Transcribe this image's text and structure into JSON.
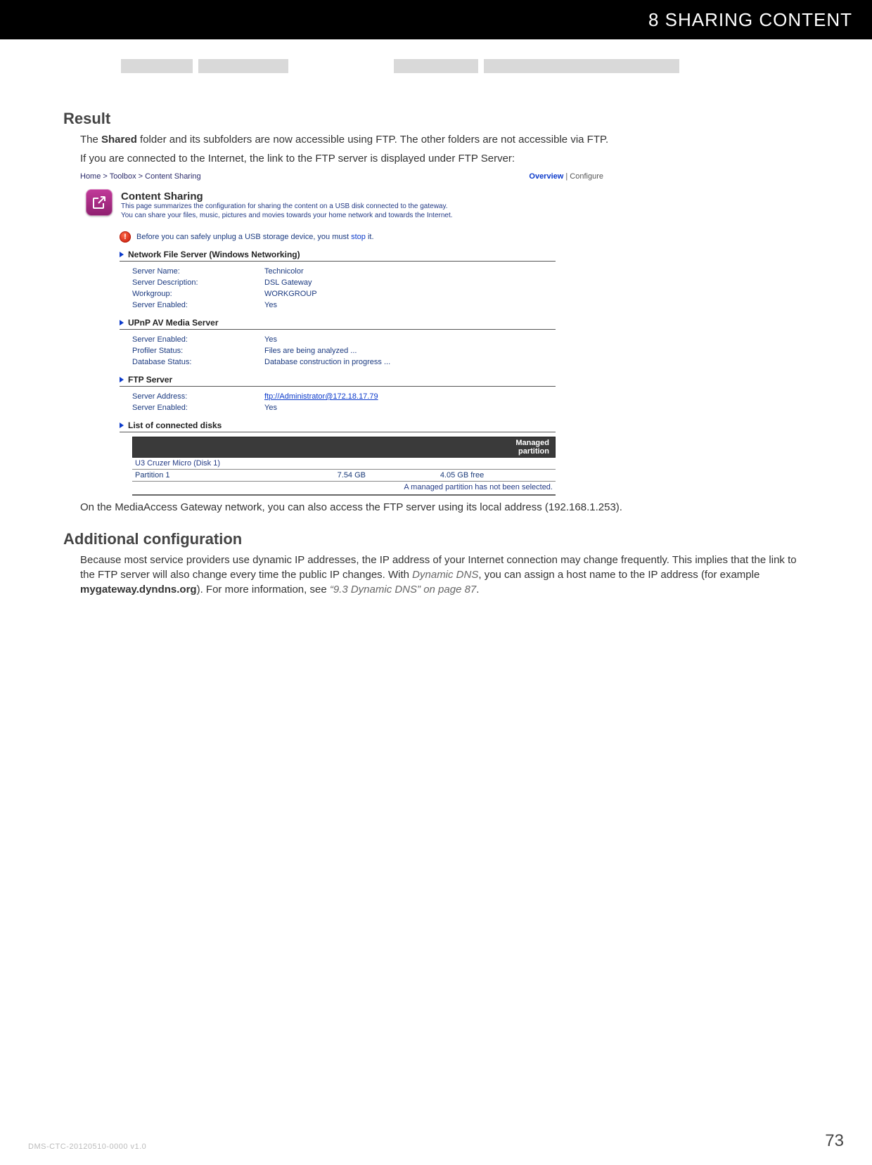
{
  "header": {
    "chapter_number": "8",
    "chapter_title": "SHARING CONTENT"
  },
  "sections": {
    "result": {
      "heading": "Result",
      "p1_a": "The ",
      "p1_bold": "Shared",
      "p1_b": " folder and its subfolders are now accessible using FTP. The other folders are not accessible via FTP.",
      "p2": "If you are connected to the Internet, the link to the FTP server is displayed under FTP Server:",
      "p3_a": "On the MediaAccess Gateway network, you can also access the FTP server using its local address (",
      "p3_ip": "192.168.1.253",
      "p3_b": ")."
    },
    "additional": {
      "heading": "Additional configuration",
      "p_a": "Because most service providers use dynamic IP addresses, the IP address of your Internet connection may change frequently. This implies that the link to the FTP server will also change every time the public IP changes. With ",
      "p_dns": "Dynamic DNS",
      "p_b": ", you can assign a host name to the IP address (for example ",
      "p_host": "mygateway.dyndns.org",
      "p_c": "). For more information, see ",
      "p_ref": "“9.3 Dynamic DNS” on page 87",
      "p_d": "."
    }
  },
  "screenshot": {
    "breadcrumb": {
      "home": "Home",
      "sep": " > ",
      "toolbox": "Toolbox",
      "page": "Content Sharing"
    },
    "tabs": {
      "overview": "Overview",
      "sep": " | ",
      "configure": "Configure"
    },
    "title": "Content Sharing",
    "desc": "This page summarizes the configuration for sharing the content on a USB disk connected to the gateway.\nYou can share your files, music, pictures and movies towards your home network and towards the Internet.",
    "warning": {
      "prefix": "Before you can safely unplug a USB storage device, you must ",
      "link": "stop",
      "suffix": " it."
    },
    "nfs": {
      "title": "Network File Server (Windows Networking)",
      "rows": {
        "server_name": {
          "k": "Server Name:",
          "v": "Technicolor"
        },
        "server_desc": {
          "k": "Server Description:",
          "v": "DSL Gateway"
        },
        "workgroup": {
          "k": "Workgroup:",
          "v": "WORKGROUP"
        },
        "enabled": {
          "k": "Server Enabled:",
          "v": "Yes"
        }
      }
    },
    "upnp": {
      "title": "UPnP AV Media Server",
      "rows": {
        "enabled": {
          "k": "Server Enabled:",
          "v": "Yes"
        },
        "profiler": {
          "k": "Profiler Status:",
          "v": "Files are being analyzed ..."
        },
        "database": {
          "k": "Database Status:",
          "v": "Database construction in progress ..."
        }
      }
    },
    "ftp": {
      "title": "FTP Server",
      "rows": {
        "address": {
          "k": "Server Address:",
          "v": "ftp://Administrator@172.18.17.79"
        },
        "enabled": {
          "k": "Server Enabled:",
          "v": "Yes"
        }
      }
    },
    "disks": {
      "title": "List of connected disks",
      "header": "Managed\npartition",
      "disk_name": "U3 Cruzer Micro (Disk 1)",
      "partition_label": "Partition 1",
      "partition_size": "7.54 GB",
      "partition_free": "4.05 GB free",
      "note": "A managed partition has not been selected."
    }
  },
  "footer": {
    "doc_id": "DMS-CTC-20120510-0000 v1.0",
    "page": "73"
  }
}
